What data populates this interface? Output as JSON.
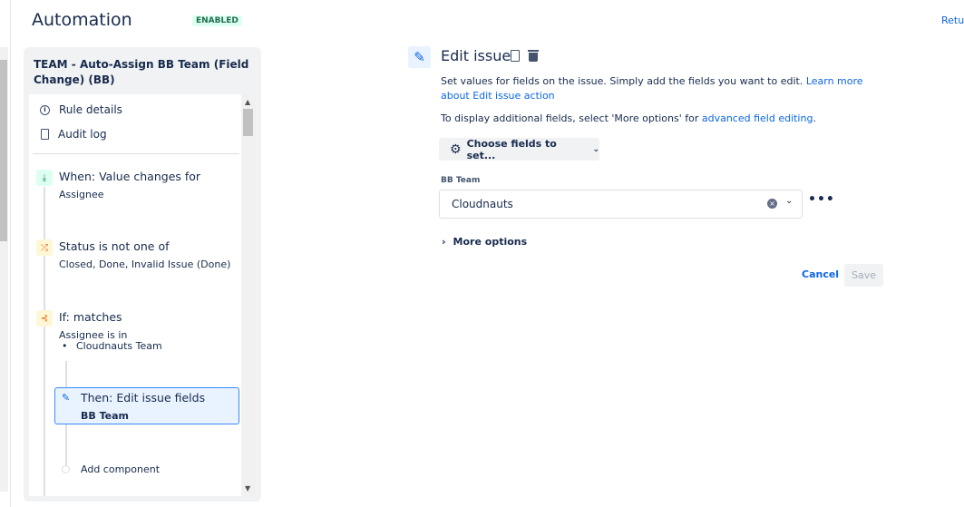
{
  "header": {
    "title": "Automation",
    "status": "ENABLED",
    "return_link": "Retu"
  },
  "rule": {
    "name": "TEAM - Auto-Assign BB Team (Field Change) (BB)",
    "menu": [
      {
        "label": "Rule details",
        "icon": "info-icon"
      },
      {
        "label": "Audit log",
        "icon": "document-icon"
      }
    ],
    "steps": [
      {
        "title": "When: Value changes for",
        "detail": "Assignee",
        "icon": "trigger-icon"
      },
      {
        "title": "Status is not one of",
        "detail": "Closed, Done, Invalid Issue (Done)",
        "icon": "condition-icon"
      },
      {
        "title": "If: matches",
        "detail": "Assignee is in",
        "bullet": "Cloudnauts Team",
        "icon": "branch-icon"
      },
      {
        "title": "Then: Edit issue fields",
        "detail": "BB Team",
        "icon": "pencil-icon"
      }
    ],
    "add_component": "Add component"
  },
  "editor": {
    "title": "Edit issue",
    "desc": "Set values for fields on the issue. Simply add the fields you want to edit. ",
    "desc_link": "Learn more about Edit issue action",
    "desc2": "To display additional fields, select 'More options' for ",
    "desc2_link": "advanced field editing",
    "desc2_end": ".",
    "choose_fields": "Choose fields to set...",
    "field_label": "BB Team",
    "field_value": "Cloudnauts",
    "more_options": "More options",
    "cancel": "Cancel",
    "save": "Save"
  }
}
